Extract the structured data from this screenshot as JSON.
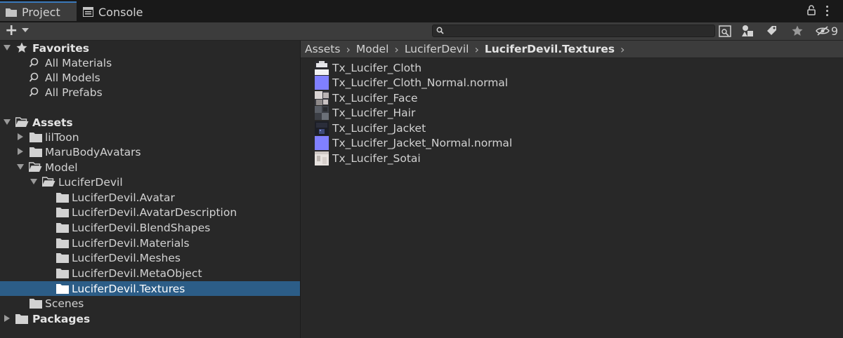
{
  "tabs": {
    "project": "Project",
    "console": "Console"
  },
  "toolbar": {
    "search_placeholder": "",
    "hidden_count": "9"
  },
  "tree": {
    "favorites": {
      "label": "Favorites",
      "items": [
        "All Materials",
        "All Models",
        "All Prefabs"
      ]
    },
    "assets": {
      "label": "Assets",
      "lilToon": "lilToon",
      "maru": "MaruBodyAvatars",
      "model": "Model",
      "lucifer": "LuciferDevil",
      "lucifer_children": [
        "LuciferDevil.Avatar",
        "LuciferDevil.AvatarDescription",
        "LuciferDevil.BlendShapes",
        "LuciferDevil.Materials",
        "LuciferDevil.Meshes",
        "LuciferDevil.MetaObject",
        "LuciferDevil.Textures"
      ],
      "scenes": "Scenes"
    },
    "packages": "Packages"
  },
  "breadcrumb": [
    "Assets",
    "Model",
    "LuciferDevil",
    "LuciferDevil.Textures"
  ],
  "files": [
    {
      "name": "Tx_Lucifer_Cloth",
      "thumb": "cloth"
    },
    {
      "name": "Tx_Lucifer_Cloth_Normal.normal",
      "thumb": "normal"
    },
    {
      "name": "Tx_Lucifer_Face",
      "thumb": "face"
    },
    {
      "name": "Tx_Lucifer_Hair",
      "thumb": "hair"
    },
    {
      "name": "Tx_Lucifer_Jacket",
      "thumb": "jacket"
    },
    {
      "name": "Tx_Lucifer_Jacket_Normal.normal",
      "thumb": "normal"
    },
    {
      "name": "Tx_Lucifer_Sotai",
      "thumb": "sotai"
    }
  ],
  "colors": {
    "selection": "#2c5d87",
    "accent": "#3a79bb",
    "normal_map": "#8080ff"
  }
}
